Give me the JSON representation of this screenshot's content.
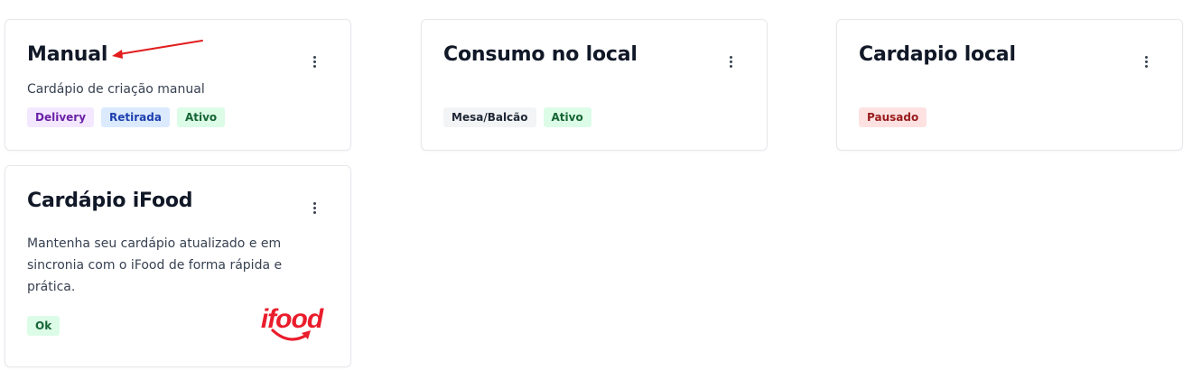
{
  "cards": [
    {
      "title": "Manual",
      "description": "Cardápio de criação manual",
      "badges": [
        "Delivery",
        "Retirada",
        "Ativo"
      ]
    },
    {
      "title": "Consumo no local",
      "description": "",
      "badges": [
        "Mesa/Balcão",
        "Ativo"
      ]
    },
    {
      "title": "Cardapio local",
      "description": "",
      "badges": [
        "Pausado"
      ]
    },
    {
      "title": "Cardápio iFood",
      "description": "Mantenha seu cardápio atualizado e em sincronia com o iFood de forma rápida e prática.",
      "badges": [
        "Ok"
      ],
      "logo_text": "ifood"
    }
  ],
  "colors": {
    "ifood_red": "#ea1d2c",
    "annotation_arrow": "#e11d1d"
  }
}
